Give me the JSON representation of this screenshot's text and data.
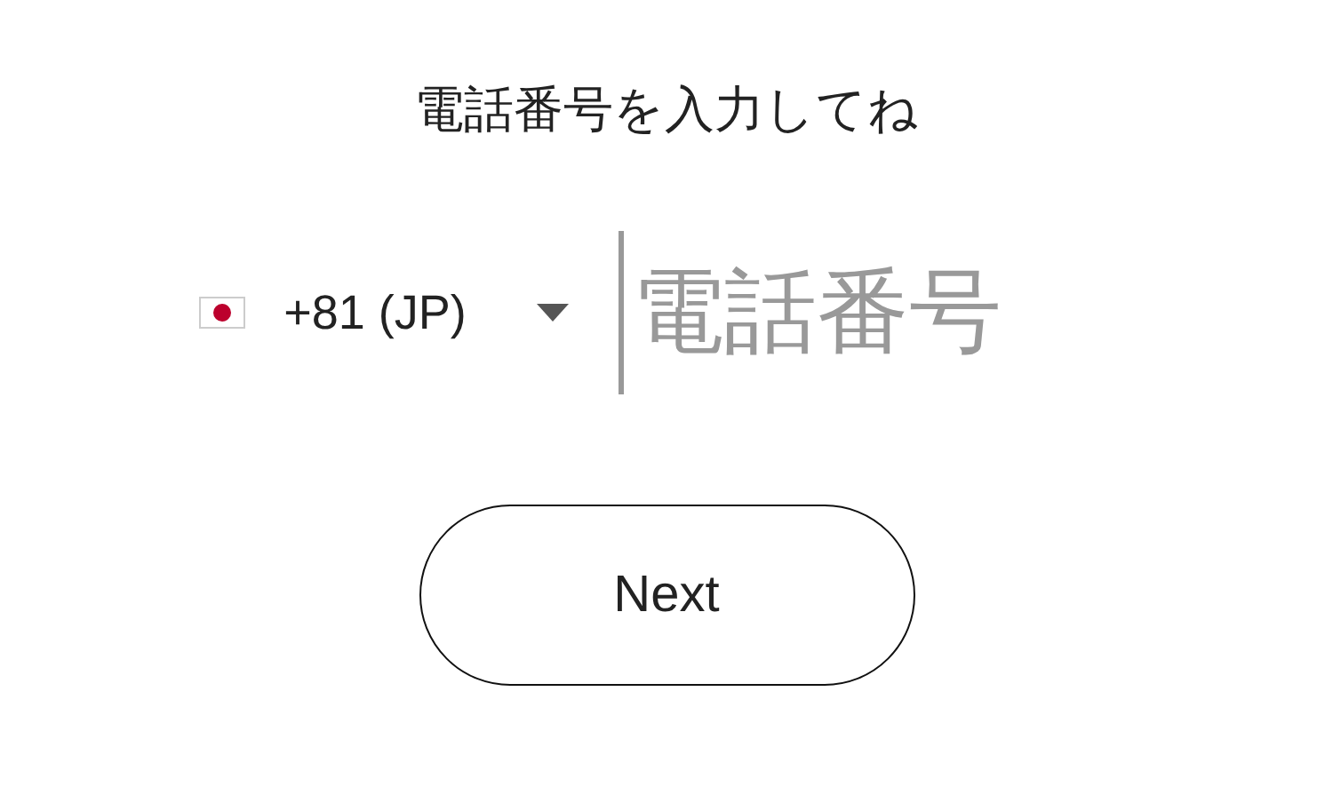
{
  "title": "電話番号を入力してね",
  "country": {
    "code": "+81 (JP)"
  },
  "phone": {
    "placeholder": "電話番号"
  },
  "button": {
    "label": "Next"
  }
}
